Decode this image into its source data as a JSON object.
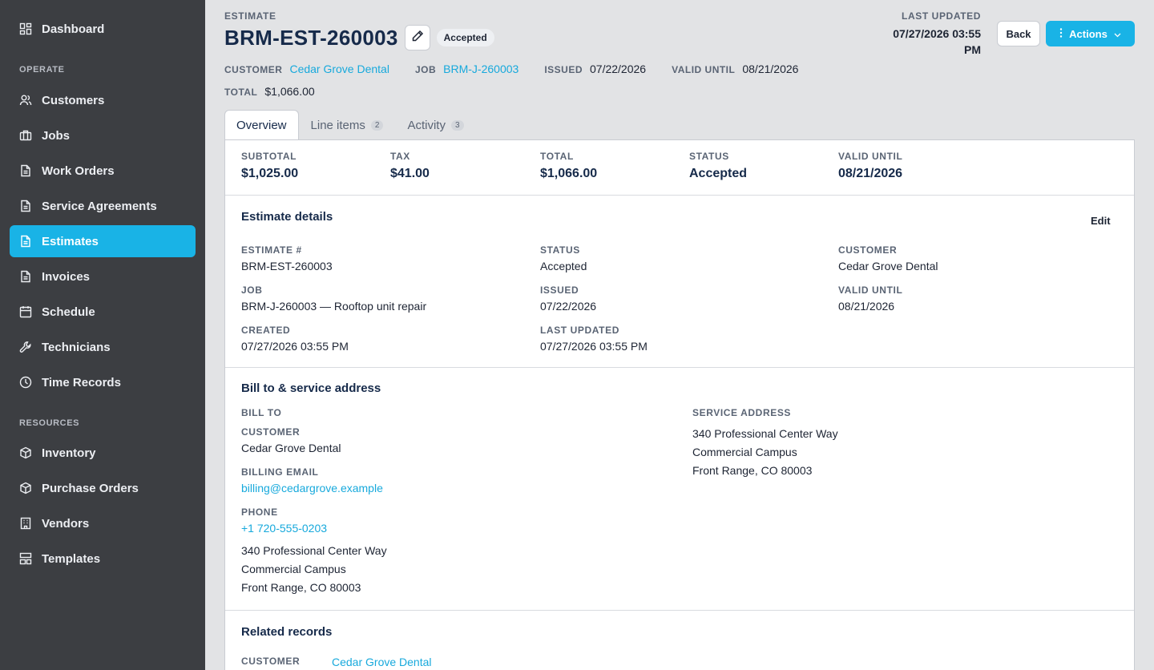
{
  "sidebar": {
    "items": [
      {
        "label": "Dashboard",
        "icon": "dashboard-icon"
      },
      {
        "section": "OPERATE"
      },
      {
        "label": "Customers",
        "icon": "users-icon"
      },
      {
        "label": "Jobs",
        "icon": "briefcase-icon"
      },
      {
        "label": "Work Orders",
        "icon": "document-icon"
      },
      {
        "label": "Service Agreements",
        "icon": "document-icon"
      },
      {
        "label": "Estimates",
        "icon": "document-icon",
        "active": true
      },
      {
        "label": "Invoices",
        "icon": "document-icon"
      },
      {
        "label": "Schedule",
        "icon": "calendar-icon"
      },
      {
        "label": "Technicians",
        "icon": "wrench-icon"
      },
      {
        "label": "Time Records",
        "icon": "clock-icon"
      },
      {
        "section": "RESOURCES"
      },
      {
        "label": "Inventory",
        "icon": "box-icon"
      },
      {
        "label": "Purchase Orders",
        "icon": "box-icon"
      },
      {
        "label": "Vendors",
        "icon": "building-icon"
      },
      {
        "label": "Templates",
        "icon": "template-icon"
      }
    ]
  },
  "header": {
    "eyebrow": "ESTIMATE",
    "title": "BRM-EST-260003",
    "status_badge": "Accepted",
    "meta": {
      "customer_label": "CUSTOMER",
      "customer": "Cedar Grove Dental",
      "job_label": "JOB",
      "job": "BRM-J-260003",
      "issued_label": "ISSUED",
      "issued": "07/22/2026",
      "valid_label": "VALID UNTIL",
      "valid": "08/21/2026",
      "total_label": "TOTAL",
      "total": "$1,066.00"
    },
    "last_updated_label": "LAST UPDATED",
    "last_updated": "07/27/2026 03:55 PM",
    "back_label": "Back",
    "actions_label": "Actions"
  },
  "tabs": [
    {
      "label": "Overview",
      "active": true
    },
    {
      "label": "Line items",
      "count": "2"
    },
    {
      "label": "Activity",
      "count": "3"
    }
  ],
  "summary": {
    "subtotal_label": "SUBTOTAL",
    "subtotal": "$1,025.00",
    "tax_label": "TAX",
    "tax": "$41.00",
    "total_label": "TOTAL",
    "total": "$1,066.00",
    "status_label": "STATUS",
    "status": "Accepted",
    "valid_label": "VALID UNTIL",
    "valid": "08/21/2026"
  },
  "details": {
    "title": "Estimate details",
    "edit_label": "Edit",
    "estimate_no_label": "ESTIMATE #",
    "estimate_no": "BRM-EST-260003",
    "status_label": "STATUS",
    "status": "Accepted",
    "customer_label": "CUSTOMER",
    "customer": "Cedar Grove Dental",
    "job_label": "JOB",
    "job": "BRM-J-260003 — Rooftop unit repair",
    "issued_label": "ISSUED",
    "issued": "07/22/2026",
    "valid_label": "VALID UNTIL",
    "valid": "08/21/2026",
    "created_label": "CREATED",
    "created": "07/27/2026 03:55 PM",
    "updated_label": "LAST UPDATED",
    "updated": "07/27/2026 03:55 PM"
  },
  "address": {
    "title": "Bill to & service address",
    "bill_to_label": "BILL TO",
    "customer_label": "CUSTOMER",
    "customer": "Cedar Grove Dental",
    "email_label": "BILLING EMAIL",
    "email": "billing@cedargrove.example",
    "phone_label": "PHONE",
    "phone": "+1 720-555-0203",
    "bill_lines": [
      "340 Professional Center Way",
      "Commercial Campus",
      "Front Range, CO 80003"
    ],
    "service_label": "SERVICE ADDRESS",
    "service_lines": [
      "340 Professional Center Way",
      "Commercial Campus",
      "Front Range, CO 80003"
    ]
  },
  "related": {
    "title": "Related records",
    "customer_label": "CUSTOMER",
    "customer": "Cedar Grove Dental"
  },
  "colors": {
    "accent": "#19b3e6",
    "sidebar": "#3c3e42",
    "link": "#17a9dc",
    "title": "#162a4a"
  }
}
